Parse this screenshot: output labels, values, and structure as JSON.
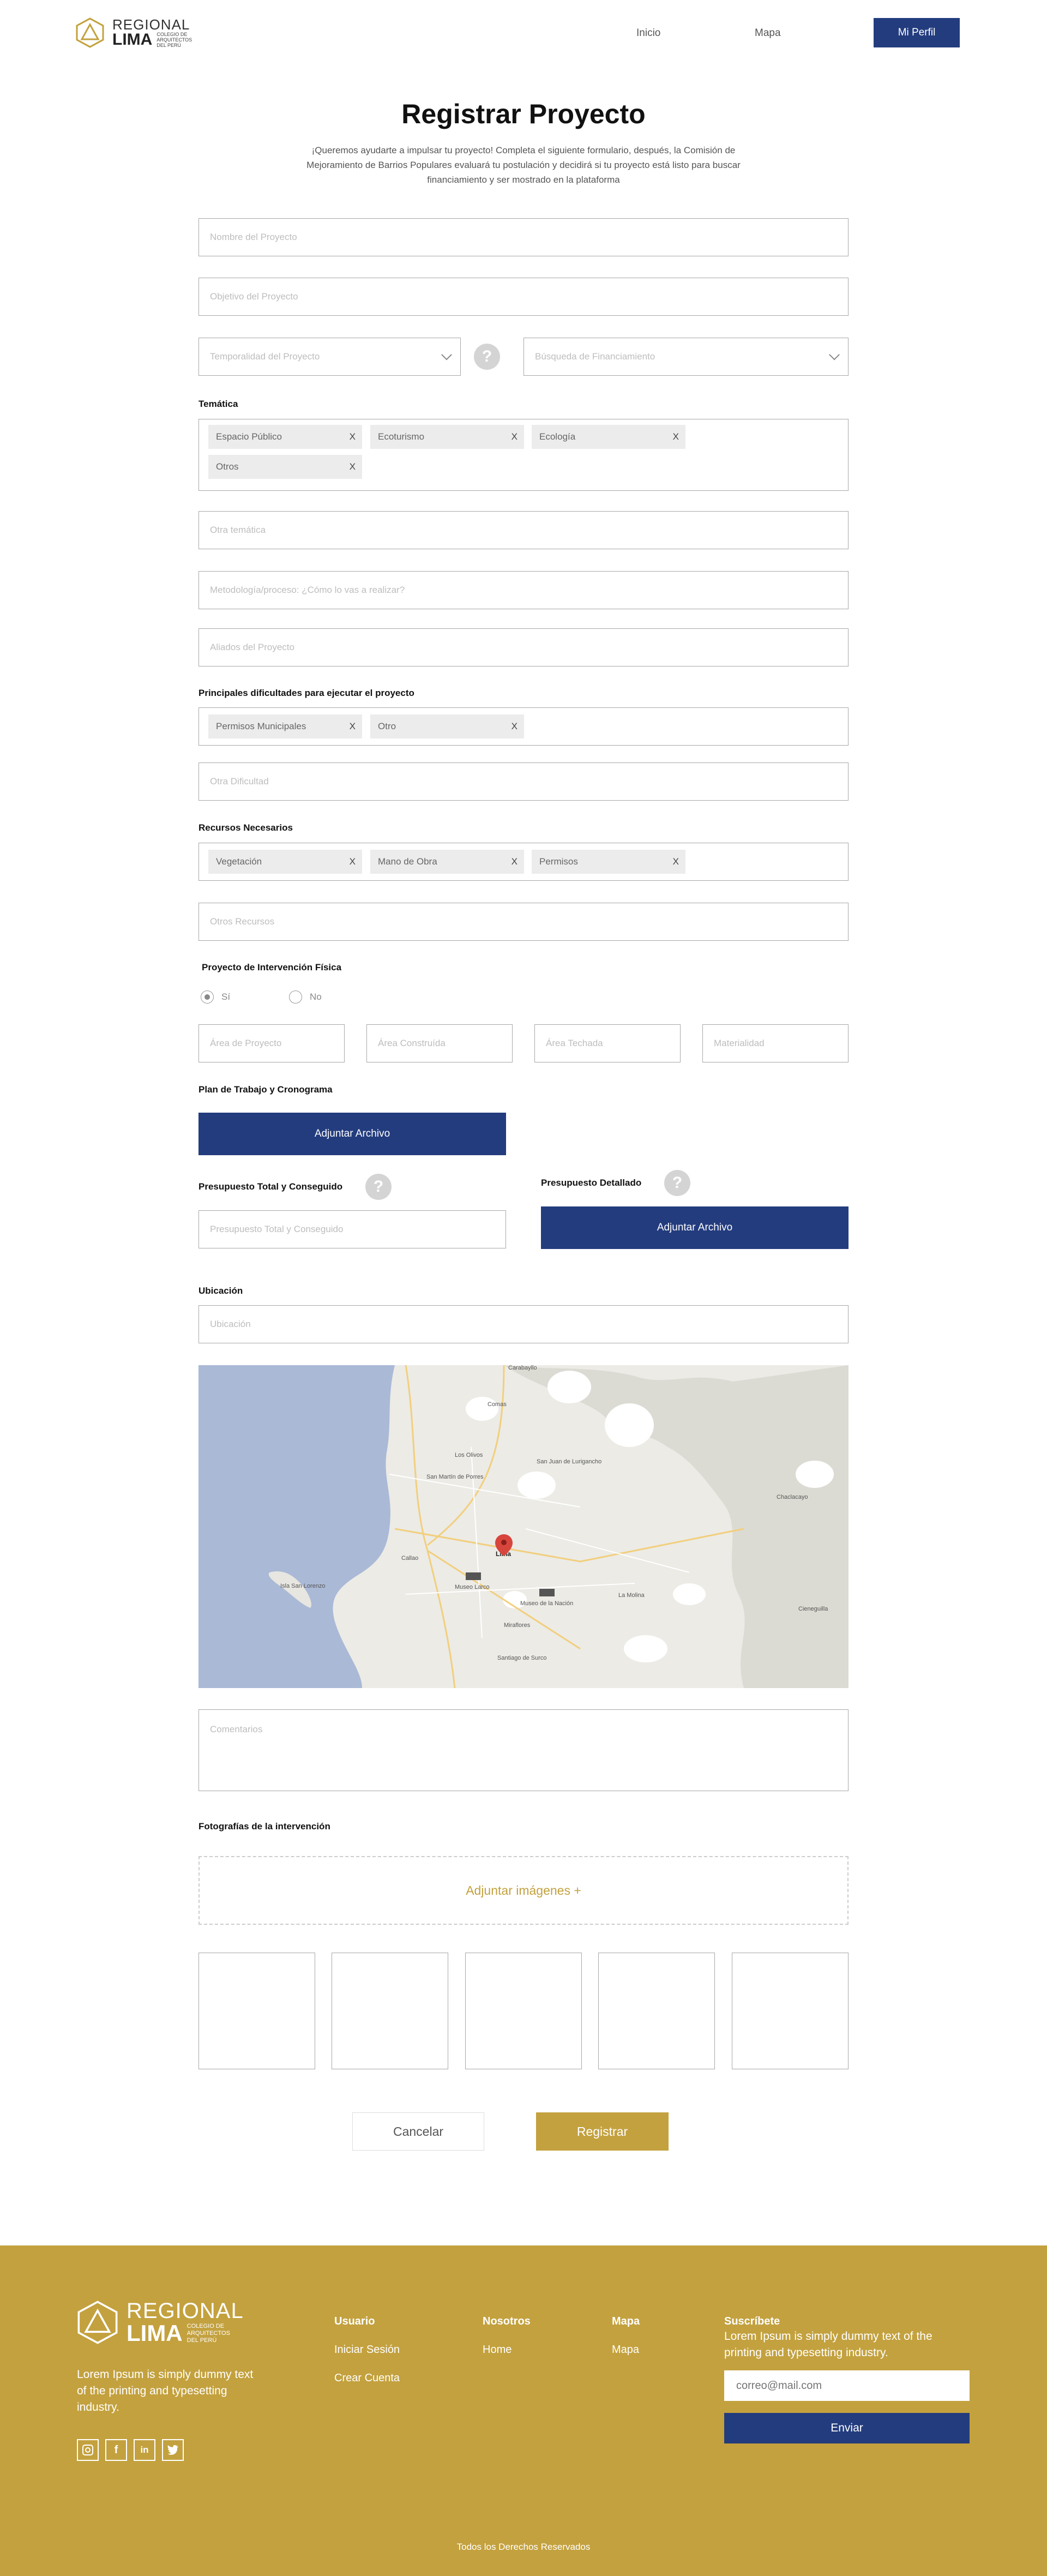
{
  "header": {
    "logo": {
      "line1": "REGIONAL",
      "line2": "LIMA",
      "sub": [
        "COLEGIO DE",
        "ARQUITECTOS",
        "DEL PERÚ"
      ]
    },
    "nav": [
      "Inicio",
      "Mapa"
    ],
    "profile_button": "Mi Perfil"
  },
  "page": {
    "title": "Registrar Proyecto",
    "intro": "¡Queremos ayudarte a impulsar tu proyecto! Completa el siguiente formulario, después, la Comisión de Mejoramiento de Barrios Populares evaluará tu postulación y decidirá si tu proyecto está listo para buscar financiamiento y ser mostrado en la plataforma"
  },
  "form": {
    "nombre": "Nombre del Proyecto",
    "objetivo": "Objetivo del Proyecto",
    "temporalidad": "Temporalidad del Proyecto",
    "financiamiento": "Búsqueda de Financiamiento",
    "help": "?",
    "tematica_label": "Temática",
    "tematica_tags": [
      "Espacio Público",
      "Ecoturismo",
      "Ecología",
      "Otros"
    ],
    "otra_tematica": "Otra temática",
    "metodologia": "Metodología/proceso: ¿Cómo lo vas a realizar?",
    "aliados": "Aliados del Proyecto",
    "dificultades_label": "Principales dificultades para ejecutar el proyecto",
    "dificultades_tags": [
      "Permisos Municipales",
      "Otro"
    ],
    "otra_dificultad": "Otra Dificultad",
    "recursos_label": "Recursos Necesarios",
    "recursos_tags": [
      "Vegetación",
      "Mano de Obra",
      "Permisos"
    ],
    "otros_recursos": "Otros Recursos",
    "tag_remove": "X",
    "intervencion_label": "Proyecto de Intervención Física",
    "radio_si": "Sí",
    "radio_no": "No",
    "area_proyecto": "Área de Proyecto",
    "area_construida": "Área Construída",
    "area_techada": "Área Techada",
    "materialidad": "Materialidad",
    "plan_label": "Plan de Trabajo y Cronograma",
    "adjuntar": "Adjuntar Archivo",
    "presupuesto_total_label": "Presupuesto Total y Conseguido",
    "presupuesto_total_ph": "Presupuesto Total y Conseguido",
    "presupuesto_detallado_label": "Presupuesto Detallado",
    "ubicacion_label": "Ubicación",
    "ubicacion_ph": "Ubicación",
    "comentarios": "Comentarios",
    "fotos_label": "Fotografías de la intervención",
    "adjuntar_imagenes": "Adjuntar imágenes +",
    "cancelar": "Cancelar",
    "registrar": "Registrar"
  },
  "map": {
    "labels": [
      "Carabayllo",
      "Comas",
      "Los Olivos",
      "San Martín de Porres",
      "San Juan de Lurigancho",
      "Callao",
      "Lima",
      "Isla San Lorenzo",
      "Museo Larco",
      "Museo de la Nación",
      "La Molina",
      "Miraflores",
      "Santiago de Surco",
      "Chaclacayo",
      "Cieneguilla"
    ]
  },
  "footer": {
    "description": "Lorem Ipsum is simply dummy text of the printing and typesetting industry.",
    "usuario": {
      "title": "Usuario",
      "links": [
        "Iniciar Sesión",
        "Crear Cuenta"
      ]
    },
    "nosotros": {
      "title": "Nosotros",
      "links": [
        "Home"
      ]
    },
    "mapa": {
      "title": "Mapa",
      "links": [
        "Mapa"
      ]
    },
    "suscribete": {
      "title": "Suscríbete",
      "text": "Lorem Ipsum is simply dummy text of the printing and typesetting industry.",
      "email_placeholder": "correo@mail.com",
      "button": "Enviar"
    },
    "copyright": "Todos los Derechos Reservados"
  }
}
